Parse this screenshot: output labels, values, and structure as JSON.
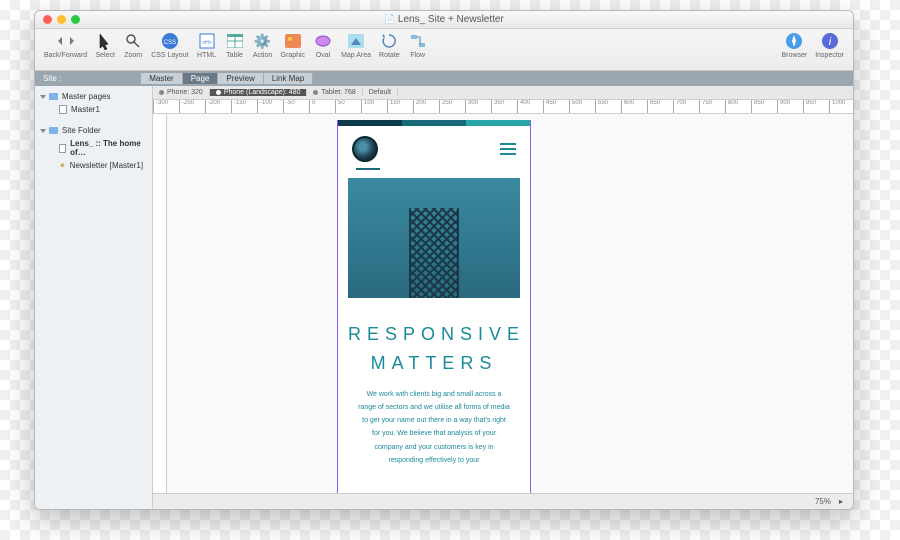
{
  "window": {
    "title": "Lens_ Site + Newsletter"
  },
  "toolbar": {
    "back_forward": "Back/Forward",
    "select": "Select",
    "zoom": "Zoom",
    "css_layout": "CSS Layout",
    "html": "HTML",
    "table": "Table",
    "action": "Action",
    "graphic": "Graphic",
    "oval": "Oval",
    "map_area": "Map Area",
    "rotate": "Rotate",
    "flow": "Flow",
    "browser": "Browser",
    "inspector": "Inspector"
  },
  "sitebar": {
    "label": "Site :"
  },
  "doc_tabs": {
    "master": "Master",
    "page": "Page",
    "preview": "Preview",
    "link_map": "Link Map"
  },
  "sidebar": {
    "master_pages": "Master pages",
    "master1": "Master1",
    "site_folder": "Site Folder",
    "lens_page": "Lens_ :: The home of…",
    "newsletter": "Newsletter [Master1]"
  },
  "breakpoints": {
    "phone": "Phone: 320",
    "phone_land": "Phone (Landscape): 480",
    "tablet": "Tablet: 768",
    "default": "Default"
  },
  "ruler_ticks": [
    "-300",
    "-250",
    "-200",
    "-150",
    "-100",
    "-50",
    "0",
    "50",
    "100",
    "150",
    "200",
    "250",
    "300",
    "350",
    "400",
    "450",
    "500",
    "550",
    "600",
    "650",
    "700",
    "750",
    "800",
    "850",
    "900",
    "950",
    "1000"
  ],
  "page_content": {
    "headline_1": "RESPONSIVE",
    "headline_2": "MATTERS",
    "body": "We work with clients big and small across a range of sectors and we utilise all forms of media to get your name out there in a way that's right for you. We believe that analysis of your company and your customers is key in responding effectively to your"
  },
  "status": {
    "zoom": "75%"
  }
}
